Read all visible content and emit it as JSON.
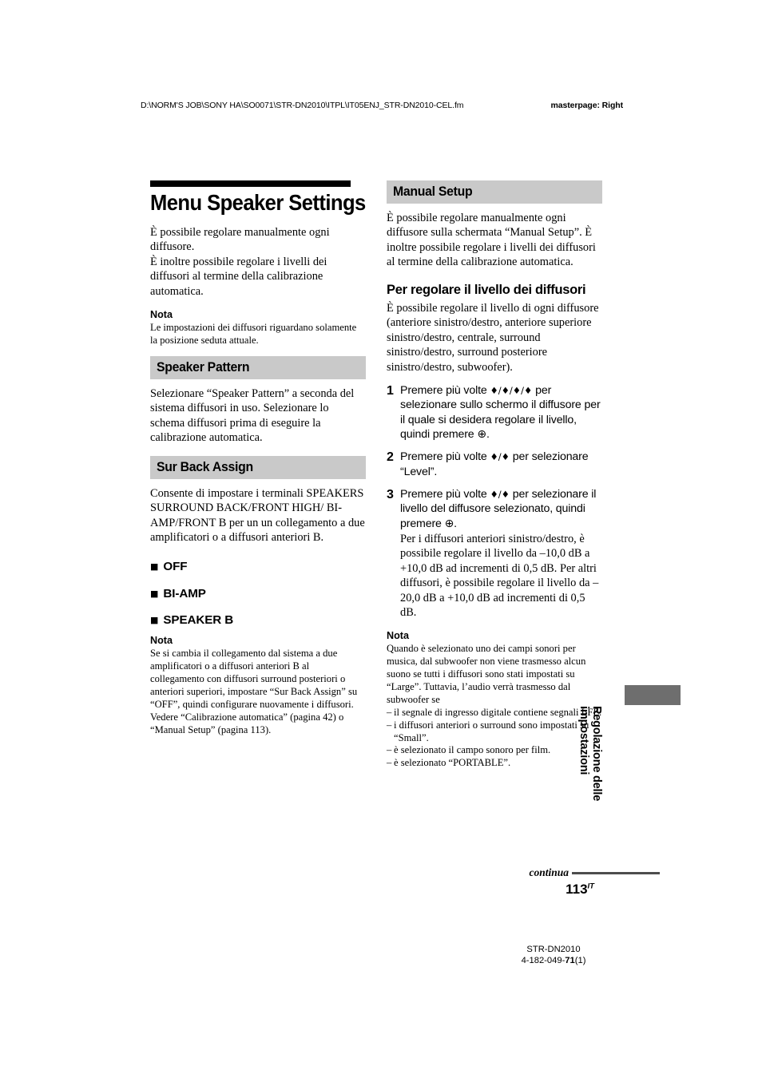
{
  "header": {
    "path": "D:\\NORM'S JOB\\SONY HA\\SO0071\\STR-DN2010\\ITPL\\IT05ENJ_STR-DN2010-CEL.fm",
    "masterpage": "masterpage: Right"
  },
  "left_column": {
    "chapter_title": "Menu Speaker Settings",
    "intro": "È possibile regolare manualmente ogni diffusore.\nÈ inoltre possibile regolare i livelli dei diffusori al termine della calibrazione automatica.",
    "nota_label": "Nota",
    "nota_text": "Le impostazioni dei diffusori riguardano solamente la posizione seduta attuale.",
    "section_speaker_pattern": {
      "title": "Speaker Pattern",
      "body": "Selezionare “Speaker Pattern” a seconda del sistema diffusori in uso. Selezionare lo schema diffusori prima di eseguire la calibrazione automatica."
    },
    "section_sur_back_assign": {
      "title": "Sur Back Assign",
      "body": "Consente di impostare i terminali SPEAKERS SURROUND BACK/FRONT HIGH/ BI-AMP/FRONT B per un un collegamento a due amplificatori o a diffusori anteriori B.",
      "options": [
        {
          "bullet": "square-bullet",
          "label": "OFF"
        },
        {
          "bullet": "square-bullet",
          "label": "BI-AMP"
        },
        {
          "bullet": "square-bullet",
          "label": "SPEAKER B"
        }
      ],
      "nota_label": "Nota",
      "nota_text": "Se si cambia il collegamento dal sistema a due amplificatori o a diffusori anteriori B al collegamento con diffusori surround posteriori o anteriori superiori, impostare “Sur Back Assign” su “OFF”, quindi configurare nuovamente i diffusori. Vedere “Calibrazione automatica” (pagina 42) o “Manual Setup” (pagina 113)."
    }
  },
  "right_column": {
    "section_manual_setup": {
      "title": "Manual Setup",
      "body": "È possibile regolare manualmente ogni diffusore sulla schermata “Manual Setup”. È inoltre possibile regolare i livelli dei diffusori al termine della calibrazione automatica."
    },
    "sub_heading": "Per regolare il livello dei diffusori",
    "sub_body": "È possibile regolare il livello di ogni diffusore (anteriore sinistro/destro, anteriore superiore sinistro/destro, centrale, surround sinistro/destro, surround posteriore sinistro/destro, subwoofer).",
    "steps": [
      {
        "number": "1",
        "text_before": "Premere più volte ",
        "glyph": "♦/♦/♦/♦",
        "text_after": " per selezionare sullo schermo il diffusore per il quale si desidera regolare il livello, quindi premere ",
        "glyph_end": "⊕",
        "text_end": "."
      },
      {
        "number": "2",
        "text_before": "Premere più volte ",
        "glyph": "♦/♦",
        "text_after": " per selezionare “Level”.",
        "glyph_end": "",
        "text_end": ""
      },
      {
        "number": "3",
        "text_before": "Premere più volte ",
        "glyph": "♦/♦",
        "text_after": " per selezionare il livello del diffusore selezionato, quindi premere ",
        "glyph_end": "⊕",
        "text_end": ".",
        "note": "Per i diffusori anteriori sinistro/destro, è possibile regolare il livello da –10,0 dB a +10,0 dB ad incrementi di 0,5 dB. Per altri diffusori, è possibile regolare il livello da –20,0 dB a +10,0 dB ad incrementi di 0,5 dB."
      }
    ],
    "nota_label": "Nota",
    "nota_text": "Quando è selezionato uno dei campi sonori per musica, dal subwoofer non viene trasmesso alcun suono se tutti i diffusori sono stati impostati su “Large”. Tuttavia, l’audio verrà trasmesso dal subwoofer se",
    "nota_items": [
      "il segnale di ingresso digitale contiene segnali LFE.",
      "i diffusori anteriori o surround sono impostati su “Small”.",
      "è selezionato il campo sonoro per film.",
      "è selezionato “PORTABLE”."
    ]
  },
  "side_tab": {
    "text": "Regolazione delle\nimpostazioni"
  },
  "footer": {
    "continua": "continua",
    "page_number": "113",
    "page_suffix": "IT",
    "model": "STR-DN2010",
    "code_prefix": "4-182-049-",
    "code_bold": "71",
    "code_suffix": "(1)"
  },
  "colors": {
    "section_bar": "#c9c9c9",
    "side_tab": "#6e6e6e",
    "rule": "#4d4d4d",
    "title_rule": "#000000"
  }
}
